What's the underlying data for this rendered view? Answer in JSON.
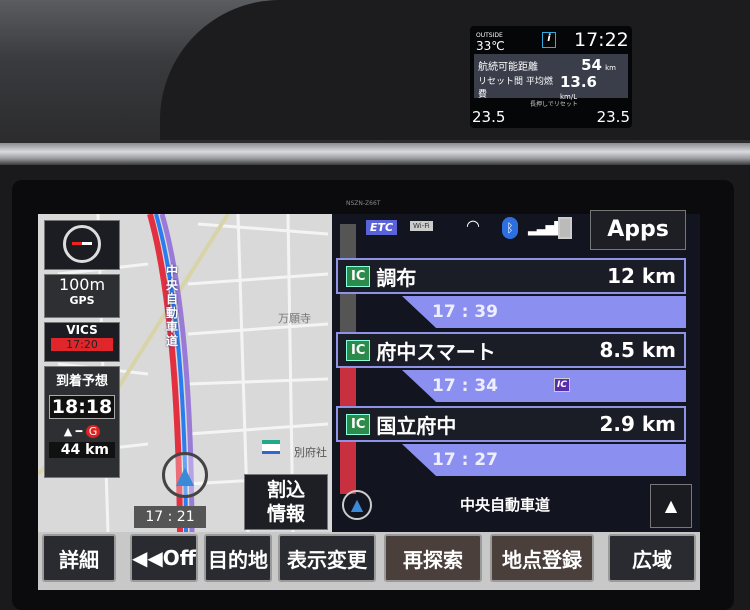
{
  "meter": {
    "outside_label": "OUTSIDE",
    "outside_temp": "33℃",
    "clock": "17:22",
    "range_label": "航続可能距離",
    "range_value": "54",
    "range_unit": "km",
    "fuel_label": "リセット間 平均燃費",
    "fuel_value": "13.6",
    "fuel_unit": "km/L",
    "reset_hint": "長押しでリセット",
    "temp_left": "23.5",
    "temp_right": "23.5"
  },
  "model": "NSZN-Z66T",
  "map": {
    "compass_icon": "compass-icon",
    "scale": "100m",
    "gps": "GPS",
    "vics_label": "VICS",
    "vics_time": "17:20",
    "eta_label": "到着予想",
    "eta_time": "18:18",
    "remaining": "44 km",
    "road_label": "中央自動車道",
    "place1": "万願寺",
    "place2": "別府社",
    "current_time": "17 : 21",
    "interrupt_label": "割込\n情報"
  },
  "status": {
    "etc": "ETC",
    "wifi": "Wi-Fi",
    "apps": "Apps"
  },
  "highway": {
    "items": [
      {
        "badge": "IC",
        "name": "調布",
        "distance": "12 km",
        "time": "17 : 39"
      },
      {
        "badge": "IC",
        "name": "府中スマート",
        "distance": "8.5 km",
        "time": "17 : 34",
        "extra": "IC"
      },
      {
        "badge": "IC",
        "name": "国立府中",
        "distance": "2.9 km",
        "time": "17 : 27"
      }
    ],
    "road": "中央自動車道",
    "up": "▲"
  },
  "buttons": [
    "詳細",
    "◀◀Off",
    "目的地",
    "表示変更",
    "再探索",
    "地点登録",
    "広域"
  ],
  "colors": {
    "route_purple": "#8a8ff0",
    "ic_green": "#2c8a4b",
    "vics_red": "#e0262a"
  }
}
